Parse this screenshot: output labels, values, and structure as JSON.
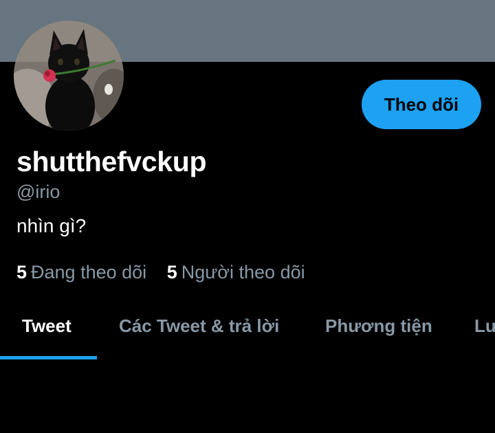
{
  "profile": {
    "display_name": "shutthefvckup",
    "handle": "@irio",
    "bio": "nhìn gì?"
  },
  "actions": {
    "follow_label": "Theo dõi"
  },
  "stats": {
    "following_count": "5",
    "following_label": "Đang theo dõi",
    "followers_count": "5",
    "followers_label": "Người theo dõi"
  },
  "tabs": [
    {
      "label": "Tweet",
      "active": true
    },
    {
      "label": "Các Tweet & trả lời",
      "active": false
    },
    {
      "label": "Phương tiện",
      "active": false
    },
    {
      "label": "Lượt thích",
      "active": false
    }
  ],
  "colors": {
    "accent": "#1da1f2",
    "banner": "#66757f",
    "secondary_text": "#8899a6",
    "background": "#000000"
  }
}
